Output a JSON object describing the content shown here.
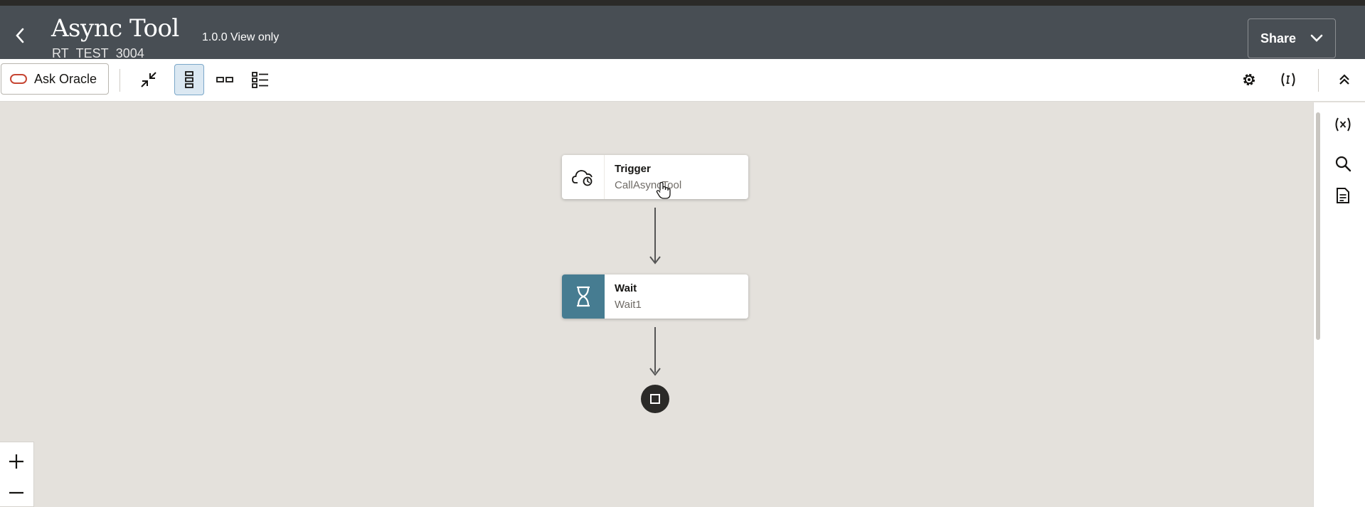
{
  "header": {
    "title": "Async Tool",
    "subtitle": "RT_TEST_3004",
    "version": "1.0.0 View only",
    "share_label": "Share"
  },
  "toolbar": {
    "ask_oracle_label": "Ask Oracle"
  },
  "flow": {
    "nodes": [
      {
        "type": "Trigger",
        "name": "CallAsyncTool",
        "icon": "cloud-trigger-icon"
      },
      {
        "type": "Wait",
        "name": "Wait1",
        "icon": "hourglass-icon"
      }
    ],
    "end_icon": "stop-square-icon"
  },
  "colors": {
    "header_bg": "#484e54",
    "canvas_bg": "#e4e1dc",
    "wait_icon_bg": "#467c91",
    "oracle_red": "#c74634",
    "selected_view_bg": "#dbe8f2"
  },
  "icons": {
    "toolbar": [
      "collapse-icon",
      "vertical-layout-icon",
      "horizontal-layout-icon",
      "pseudo-layout-icon"
    ],
    "toolbar_right": [
      "settings-gear-icon",
      "integration-properties-icon",
      "collapse-up-icon"
    ],
    "right_rail": [
      "variables-icon",
      "search-icon",
      "document-icon"
    ],
    "zoom": [
      "zoom-in-icon",
      "zoom-out-icon"
    ]
  }
}
